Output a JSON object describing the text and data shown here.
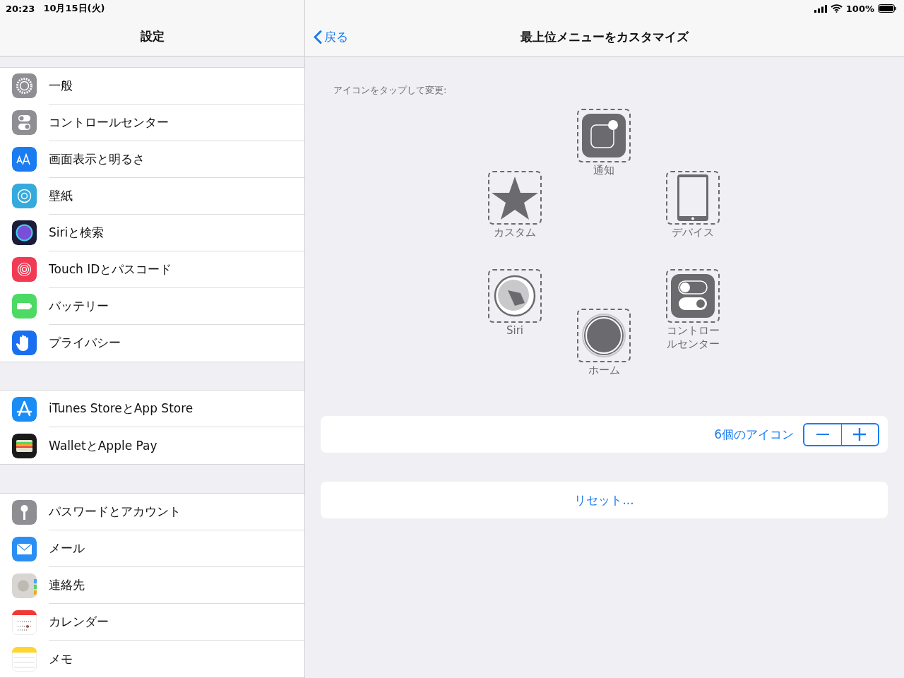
{
  "status_bar": {
    "time": "20:23",
    "date": "10月15日(火)",
    "battery": "100%"
  },
  "sidebar": {
    "title": "設定",
    "groups": [
      {
        "items": [
          {
            "label": "一般",
            "kind": "general"
          },
          {
            "label": "コントロールセンター",
            "kind": "control"
          },
          {
            "label": "画面表示と明るさ",
            "kind": "display"
          },
          {
            "label": "壁紙",
            "kind": "wallpaper"
          },
          {
            "label": "Siriと検索",
            "kind": "siri"
          },
          {
            "label": "Touch IDとパスコード",
            "kind": "touchid"
          },
          {
            "label": "バッテリー",
            "kind": "battery"
          },
          {
            "label": "プライバシー",
            "kind": "privacy"
          }
        ]
      },
      {
        "items": [
          {
            "label": "iTunes StoreとApp Store",
            "kind": "appstore"
          },
          {
            "label": "WalletとApple Pay",
            "kind": "wallet"
          }
        ]
      },
      {
        "items": [
          {
            "label": "パスワードとアカウント",
            "kind": "passwords"
          },
          {
            "label": "メール",
            "kind": "mail"
          },
          {
            "label": "連絡先",
            "kind": "contacts"
          },
          {
            "label": "カレンダー",
            "kind": "calendar"
          },
          {
            "label": "メモ",
            "kind": "notes"
          }
        ]
      }
    ]
  },
  "detail": {
    "back": "戻る",
    "title": "最上位メニューをカスタマイズ",
    "hint": "アイコンをタップして変更:",
    "menu_icons": [
      {
        "label": "通知",
        "kind": "notification"
      },
      {
        "label": "カスタム",
        "kind": "custom"
      },
      {
        "label": "デバイス",
        "kind": "device"
      },
      {
        "label": "Siri",
        "kind": "siri"
      },
      {
        "label": "ホーム",
        "kind": "home"
      },
      {
        "label": "コントロールセンター",
        "kind": "control"
      }
    ],
    "count": "6個のアイコン",
    "reset": "リセット..."
  }
}
